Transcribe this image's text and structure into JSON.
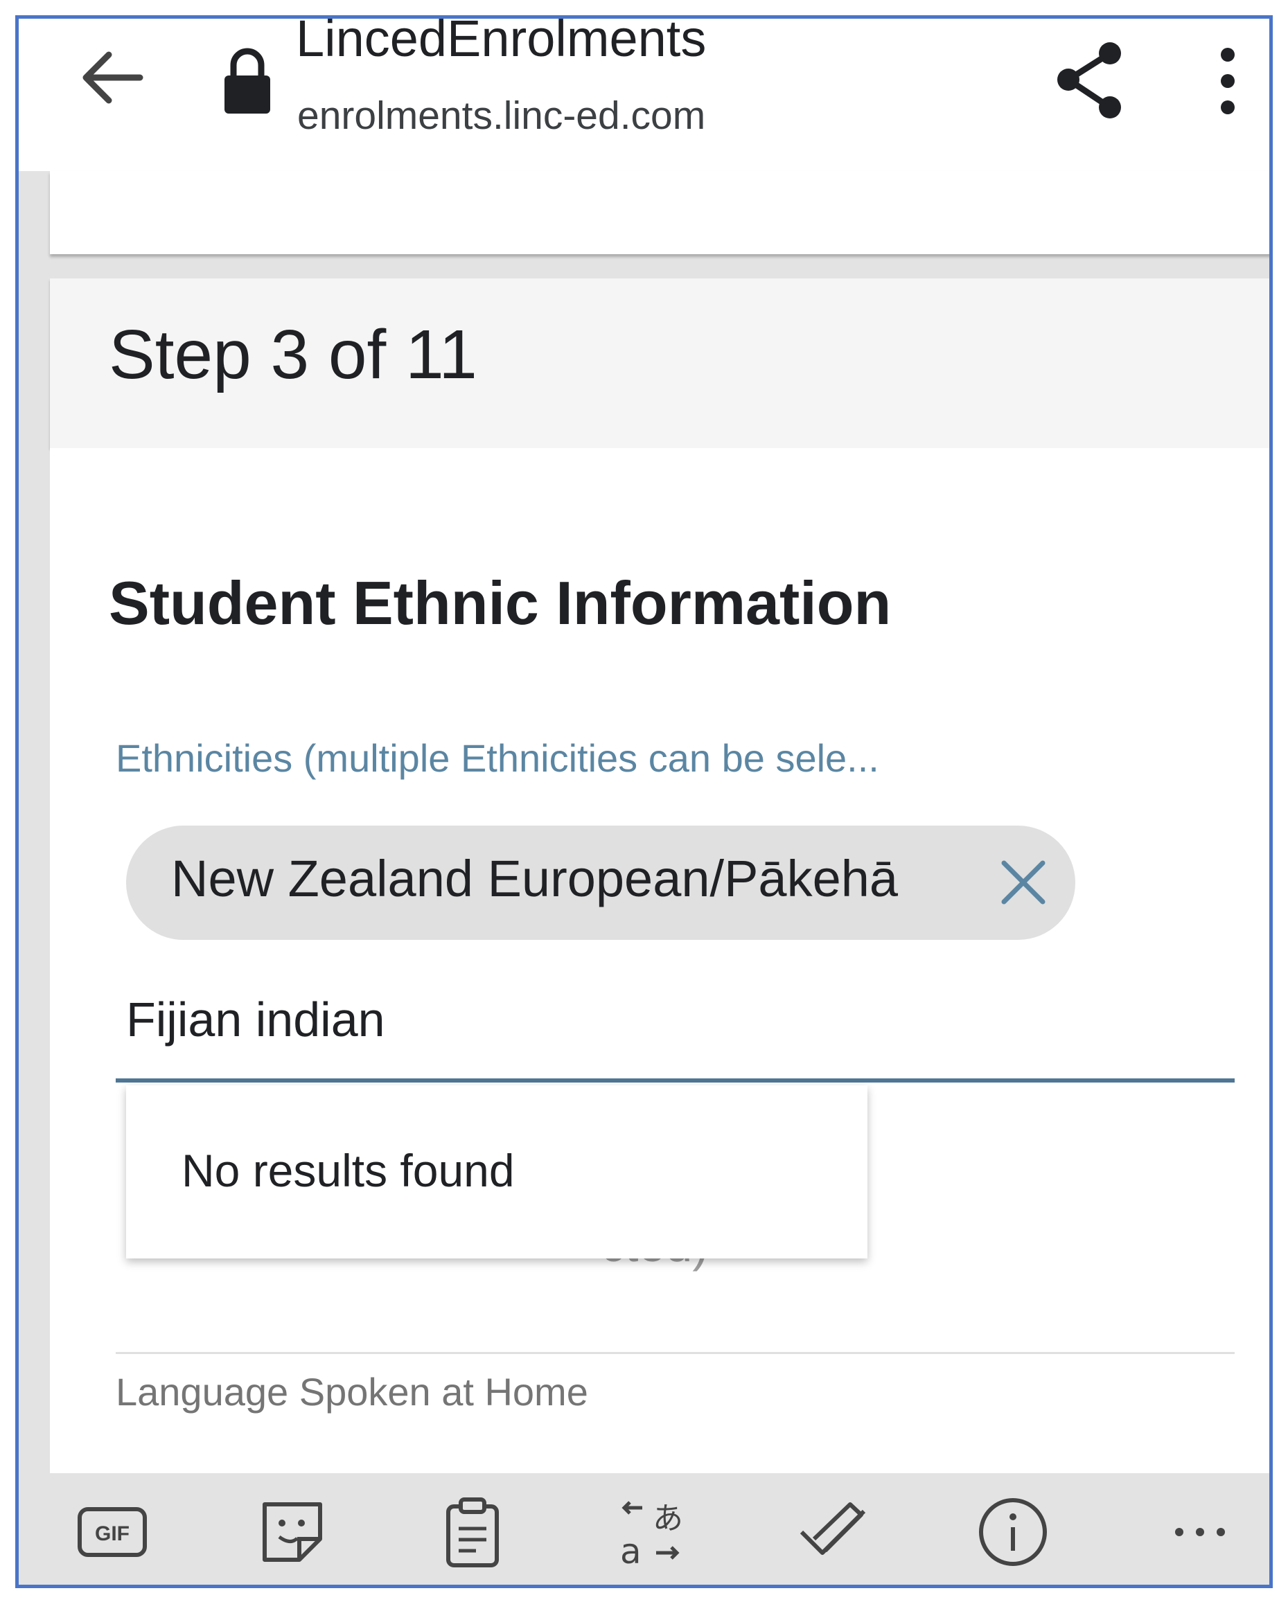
{
  "browser": {
    "site_title": "LincedEnrolments",
    "url": "enrolments.linc-ed.com",
    "icons": [
      "back-arrow-icon",
      "lock-icon",
      "share-icon",
      "more-vert-icon"
    ]
  },
  "form": {
    "step_label": "Step 3 of 11",
    "section_title": "Student Ethnic Information",
    "ethnicities_label": "Ethnicities (multiple Ethnicities can be sele...",
    "selected_chip": "New Zealand European/Pākehā",
    "search_value": "Fijian indian",
    "dropdown_message": "No results found",
    "partially_hidden_text": "cted)",
    "language_label": "Language Spoken at Home"
  },
  "keyboard_toolbar": {
    "gif_label": "GIF",
    "icons": [
      "gif-icon",
      "sticker-icon",
      "clipboard-icon",
      "translate-icon",
      "handwriting-icon",
      "info-icon",
      "more-horiz-icon"
    ]
  },
  "colors": {
    "frame_border": "#4a74c9",
    "label_blue": "#5b86a3",
    "underline": "#4f7694",
    "chip_close": "#5b86a3"
  }
}
